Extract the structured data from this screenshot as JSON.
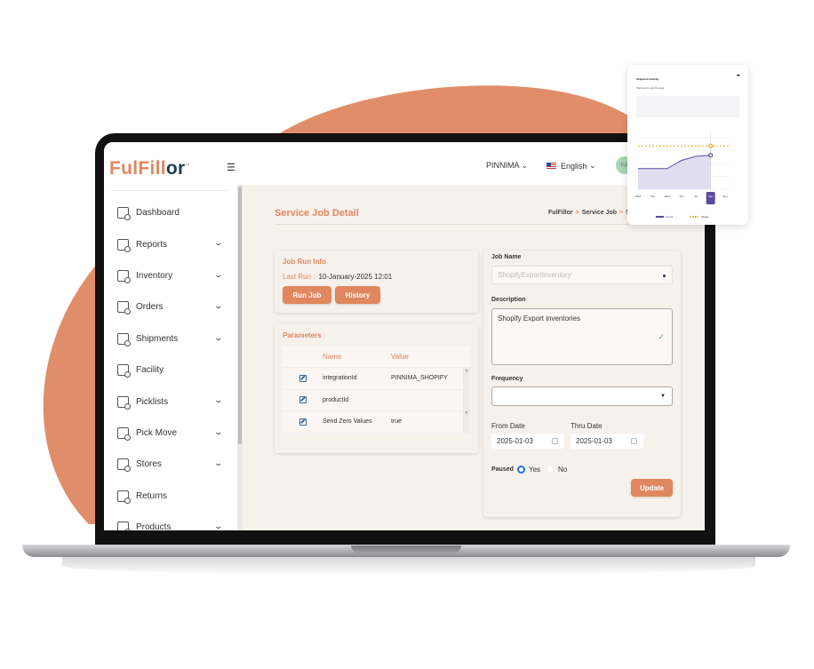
{
  "colors": {
    "brand": "#e0875f",
    "brand_dark": "#1d3a5a",
    "background_panel": "#f7f1ec",
    "radio_active": "#1a73e8",
    "chart_line": "#5b4aa0",
    "chart_target": "#f5a623"
  },
  "app": {
    "logo_main": "FulFill",
    "logo_accent": "or",
    "logo_tm": "™"
  },
  "topbar": {
    "user_label": "PINNIMA",
    "language_label": "English",
    "avatar_initials": "FA"
  },
  "sidebar": {
    "items": [
      {
        "label": "Dashboard",
        "icon": "dashboard-icon",
        "expandable": false
      },
      {
        "label": "Reports",
        "icon": "reports-icon",
        "expandable": true
      },
      {
        "label": "Inventory",
        "icon": "inventory-icon",
        "expandable": true
      },
      {
        "label": "Orders",
        "icon": "orders-icon",
        "expandable": true
      },
      {
        "label": "Shipments",
        "icon": "shipments-icon",
        "expandable": true
      },
      {
        "label": "Facility",
        "icon": "facility-icon",
        "expandable": false
      },
      {
        "label": "Picklists",
        "icon": "picklists-icon",
        "expandable": true
      },
      {
        "label": "Pick Move",
        "icon": "pick-move-icon",
        "expandable": true
      },
      {
        "label": "Stores",
        "icon": "stores-icon",
        "expandable": true
      },
      {
        "label": "Returns",
        "icon": "returns-icon",
        "expandable": false
      },
      {
        "label": "Products",
        "icon": "products-icon",
        "expandable": true
      }
    ]
  },
  "page": {
    "title": "Service Job Detail",
    "breadcrumb": [
      "FulFillor",
      "Service Job",
      "S"
    ]
  },
  "job_run": {
    "heading": "Job Run Info",
    "last_run_label": "Last Run :",
    "last_run_value": "10-January-2025 12:01",
    "run_button": "Run Job",
    "history_button": "History"
  },
  "parameters": {
    "heading": "Parameters",
    "columns": [
      "",
      "Name",
      "Value"
    ],
    "rows": [
      {
        "name": "integrationId",
        "value": "PINNIMA_SHOPIFY"
      },
      {
        "name": "productId",
        "value": ""
      },
      {
        "name": "Send Zero Values",
        "value": "true"
      }
    ]
  },
  "form": {
    "job_name_label": "Job Name",
    "job_name_value": "ShopifyExportInventory",
    "description_label": "Description",
    "description_value": "Shopify Export inventories",
    "frequency_label": "Frequency",
    "frequency_value": "",
    "from_date_label": "From Date",
    "from_date_value": "2025-01-03",
    "thru_date_label": "Thru Date",
    "thru_date_value": "2025-01-03",
    "paused_label": "Paused",
    "paused_options": [
      "Yes",
      "No"
    ],
    "paused_selected": "Yes",
    "update_button": "Update"
  },
  "floating_card": {
    "title": "Shipment Activity",
    "subtitle": "Shipments by day this week",
    "menu_icon": "more-icon",
    "chart_data": {
      "type": "area",
      "categories": [
        "Wed",
        "Thu",
        "Wed",
        "Thu",
        "Fri",
        "Sat",
        "Sun"
      ],
      "highlighted_category": "Sat",
      "series": [
        {
          "name": "Actual",
          "values": [
            2,
            2,
            2,
            2.8,
            3.2,
            3.3,
            null
          ]
        },
        {
          "name": "Target",
          "values": [
            4.2,
            4.2,
            4.2,
            4.2,
            4.2,
            4.2,
            4.2
          ]
        }
      ],
      "ylim": [
        0,
        5
      ],
      "legend": [
        "Actual",
        "Target"
      ],
      "legend_position": "bottom"
    }
  }
}
